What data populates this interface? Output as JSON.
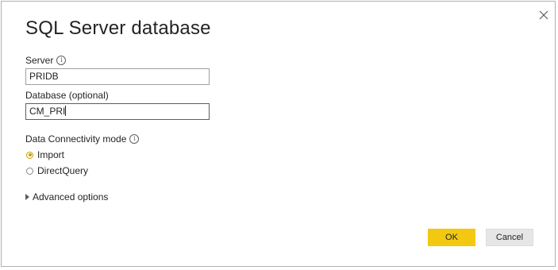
{
  "dialog": {
    "title": "SQL Server database",
    "close_icon": "close-icon"
  },
  "server": {
    "label": "Server",
    "info_icon": "info-icon",
    "value": "PRIDB"
  },
  "database": {
    "label": "Database (optional)",
    "value": "CM_PRI"
  },
  "connectivity": {
    "label": "Data Connectivity mode",
    "info_icon": "info-icon",
    "options": [
      {
        "label": "Import",
        "selected": true
      },
      {
        "label": "DirectQuery",
        "selected": false
      }
    ]
  },
  "advanced": {
    "label": "Advanced options",
    "icon": "triangle-right-icon"
  },
  "buttons": {
    "ok": "OK",
    "cancel": "Cancel"
  },
  "colors": {
    "accent": "#f2c811",
    "radio_selected": "#c8a000"
  }
}
